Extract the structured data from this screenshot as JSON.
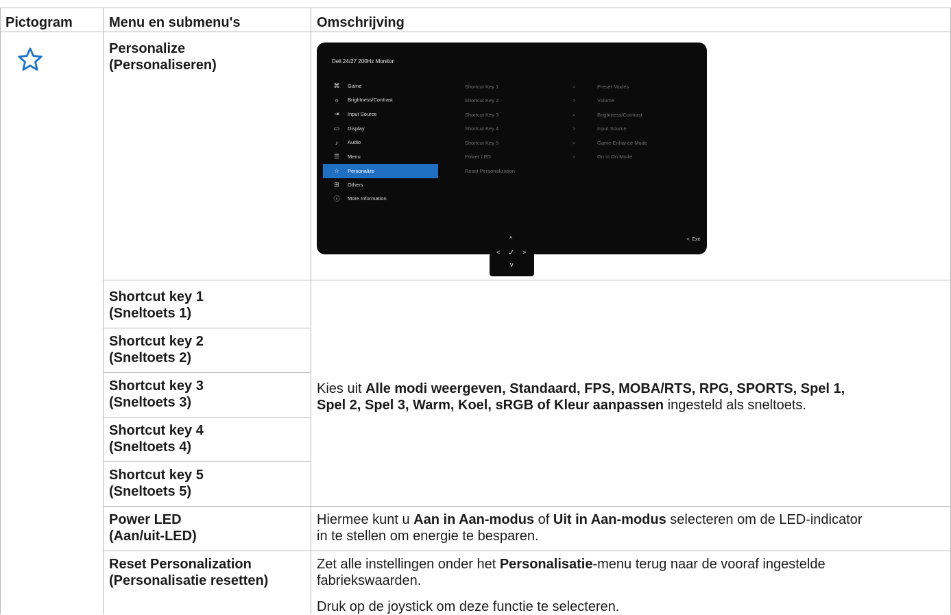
{
  "headers": {
    "pictogram": "Pictogram",
    "menu": "Menu en submenu's",
    "description": "Omschrijving"
  },
  "rows": {
    "personalize": {
      "en": "Personalize",
      "nl": "(Personaliseren)"
    },
    "shortcut1": {
      "en": "Shortcut key 1",
      "nl": "(Sneltoets 1)"
    },
    "shortcut2": {
      "en": "Shortcut key 2",
      "nl": "(Sneltoets 2)"
    },
    "shortcut3": {
      "en": "Shortcut key 3",
      "nl": "(Sneltoets 3)"
    },
    "shortcut4": {
      "en": "Shortcut key 4",
      "nl": "(Sneltoets 4)"
    },
    "shortcut5": {
      "en": "Shortcut key 5",
      "nl": "(Sneltoets 5)"
    },
    "power_led": {
      "en": "Power LED",
      "nl": "(Aan/uit-LED)"
    },
    "reset": {
      "en": "Reset Personalization",
      "nl": "(Personalisatie resetten)"
    }
  },
  "descriptions": {
    "shortcut": {
      "prefix": "Kies uit ",
      "bold1": "Alle modi weergeven, Standaard, FPS, MOBA/RTS, RPG, SPORTS, Spel 1,",
      "bold2": "Spel 2, Spel 3, Warm, Koel, sRGB of Kleur aanpassen",
      "suffix": " ingesteld als sneltoets."
    },
    "power_led": {
      "l1_a": "Hiermee kunt u ",
      "l1_b": "Aan in Aan-modus",
      "l1_c": " of ",
      "l1_d": "Uit in Aan-modus",
      "l1_e": " selecteren om de LED-indicator",
      "l2": "in te stellen om energie te besparen."
    },
    "reset": {
      "l1_a": "Zet alle instellingen onder het ",
      "l1_b": "Personalisatie",
      "l1_c": "-menu terug naar de vooraf ingestelde",
      "l2": "fabriekswaarden.",
      "l3": "Druk op de joystick om deze functie te selecteren."
    }
  },
  "osd": {
    "title": "Dell 24/27 200Hz Monitor",
    "menu_items": [
      {
        "label": "Game",
        "icon": "gamepad-icon"
      },
      {
        "label": "Brightness/Contrast",
        "icon": "brightness-icon"
      },
      {
        "label": "Input Source",
        "icon": "input-source-icon"
      },
      {
        "label": "Display",
        "icon": "display-icon"
      },
      {
        "label": "Audio",
        "icon": "speaker-icon"
      },
      {
        "label": "Menu",
        "icon": "menu-icon"
      },
      {
        "label": "Personalize",
        "icon": "star-icon"
      },
      {
        "label": "Others",
        "icon": "others-icon"
      },
      {
        "label": "More Information",
        "icon": "info-icon"
      }
    ],
    "active_item": "Personalize",
    "submenu": [
      {
        "label": "Shortcut Key 1",
        "arrow": ">",
        "value": "Preset Modes"
      },
      {
        "label": "Shortcut Key 2",
        "arrow": ">",
        "value": "Volume"
      },
      {
        "label": "Shortcut Key 3",
        "arrow": ">",
        "value": "Brightness/Contrast"
      },
      {
        "label": "Shortcut Key 4",
        "arrow": ">",
        "value": "Input Source"
      },
      {
        "label": "Shortcut Key 5",
        "arrow": ">",
        "value": "Game Enhance Mode"
      },
      {
        "label": "Power LED",
        "arrow": ">",
        "value": "On in On Mode"
      },
      {
        "label": "Reset Personalization",
        "arrow": "",
        "value": ""
      }
    ],
    "exit_label": "Exit",
    "exit_arrow": "<",
    "joystick": {
      "up": "^",
      "down": "v",
      "left": "<",
      "right": ">",
      "center": "✓"
    }
  },
  "colors": {
    "accent": "#1f6fc2",
    "icon_blue": "#1a73c7",
    "osd_background": "#0b0b0b",
    "border": "#b8b8b8"
  }
}
